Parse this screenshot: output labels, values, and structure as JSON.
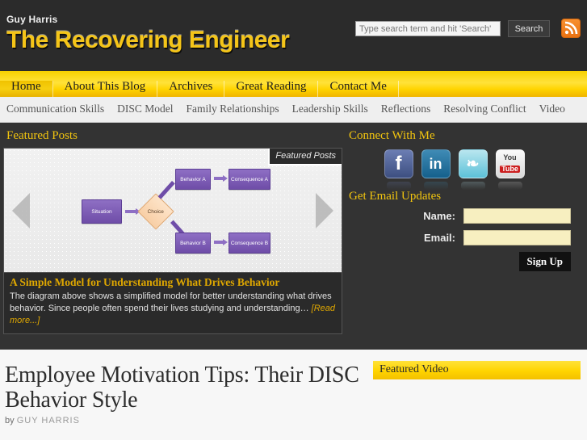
{
  "header": {
    "brand_sub": "Guy Harris",
    "brand_title": "The Recovering Engineer",
    "search_placeholder": "Type search term and hit 'Search'",
    "search_value": "",
    "search_button": "Search",
    "rss_icon": "rss-icon"
  },
  "nav_primary": [
    {
      "label": "Home",
      "active": true
    },
    {
      "label": "About This Blog",
      "active": false
    },
    {
      "label": "Archives",
      "active": false
    },
    {
      "label": "Great Reading",
      "active": false
    },
    {
      "label": "Contact Me",
      "active": false
    }
  ],
  "nav_secondary": [
    {
      "label": "Communication Skills"
    },
    {
      "label": "DISC Model"
    },
    {
      "label": "Family Relationships"
    },
    {
      "label": "Leadership Skills"
    },
    {
      "label": "Reflections"
    },
    {
      "label": "Resolving Conflict"
    },
    {
      "label": "Video"
    }
  ],
  "featured": {
    "heading": "Featured Posts",
    "badge": "Featured Posts",
    "prev_icon": "arrow-left-icon",
    "next_icon": "arrow-right-icon",
    "caption_title": "A Simple Model for Understanding What Drives Behavior",
    "caption_text": "The diagram above shows a simplified model for better understanding what drives behavior. Since people often spend their lives studying and understanding… ",
    "read_more": "[Read more...]",
    "diagram": {
      "nodes": [
        {
          "label": "Situation"
        },
        {
          "label": "Choice"
        },
        {
          "label": "Behavior A"
        },
        {
          "label": "Consequence A"
        },
        {
          "label": "Behavior B"
        },
        {
          "label": "Consequence B"
        }
      ]
    }
  },
  "sidebar": {
    "connect_heading": "Connect With Me",
    "social": [
      {
        "name": "facebook-icon",
        "glyph": "f"
      },
      {
        "name": "linkedin-icon",
        "glyph": "in"
      },
      {
        "name": "twitter-icon",
        "glyph": "❧"
      },
      {
        "name": "youtube-icon",
        "glyph_top": "You",
        "glyph_bottom": "Tube"
      }
    ],
    "email_heading": "Get Email Updates",
    "name_label": "Name:",
    "name_value": "",
    "email_label": "Email:",
    "email_value": "",
    "signup_button": "Sign Up"
  },
  "post": {
    "title": "Employee Motivation Tips: Their DISC Behavior Style",
    "by_prefix": "by ",
    "author": "GUY HARRIS"
  },
  "video": {
    "heading": "Featured Video"
  },
  "colors": {
    "brand_yellow": "#f5c518",
    "nav_yellow": "#ffd400",
    "dark": "#333333",
    "header_dark": "#2b2b2b",
    "accent_gold": "#e0a800",
    "node_purple": "#6f4da8",
    "diamond_peach": "#f8cfa6"
  }
}
